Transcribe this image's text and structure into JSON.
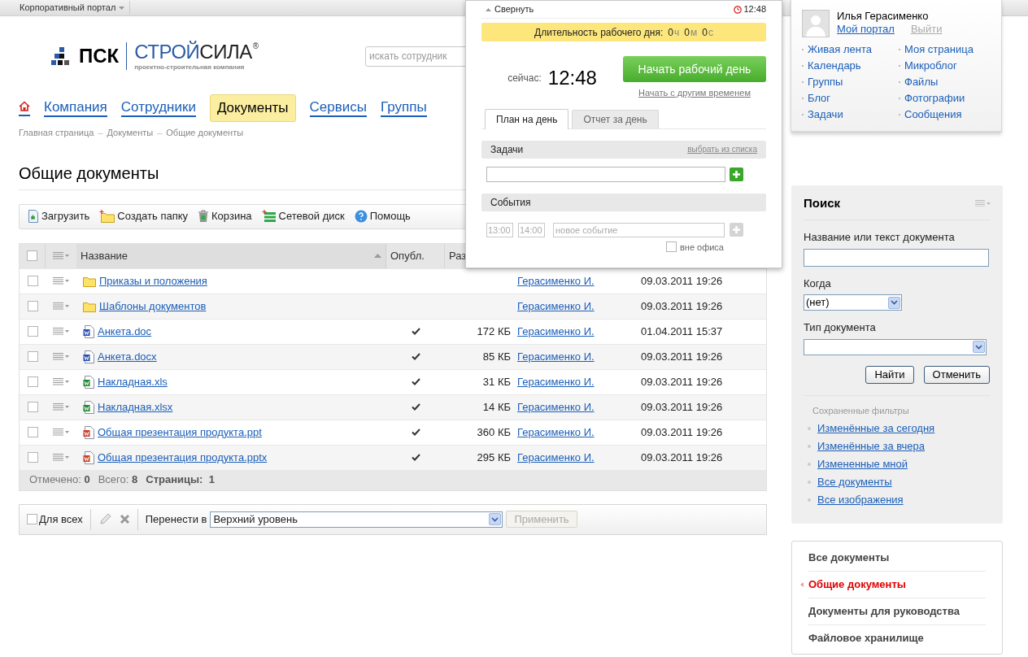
{
  "top_bar": {
    "portal_menu": "Корпоративный портал"
  },
  "logo": {
    "brand": "ПСК",
    "name_first": "СТРОЙ",
    "name_second": "СИЛА",
    "registered": "®",
    "tagline": "проектно-строительная компания"
  },
  "employee_search": {
    "placeholder": "искать сотрудник"
  },
  "nav": [
    {
      "label": "Компания",
      "selected": false
    },
    {
      "label": "Сотрудники",
      "selected": false
    },
    {
      "label": "Документы",
      "selected": true
    },
    {
      "label": "Сервисы",
      "selected": false
    },
    {
      "label": "Группы",
      "selected": false
    }
  ],
  "breadcrumbs": {
    "separator": "–",
    "items": [
      "Главная страница",
      "Документы",
      "Общие документы"
    ]
  },
  "page_title": "Общие документы",
  "toolbar": [
    {
      "label": "Загрузить",
      "kind": "upload"
    },
    {
      "label": "Создать папку",
      "kind": "folder"
    },
    {
      "label": "Корзина",
      "kind": "trash"
    },
    {
      "label": "Сетевой диск",
      "kind": "drive"
    },
    {
      "label": "Помощь",
      "kind": "help"
    }
  ],
  "table": {
    "select_all": {
      "checked": false
    },
    "columns": [
      {
        "label": "Название"
      },
      {
        "label": "Опубл."
      },
      {
        "label": "Раз"
      }
    ],
    "rows": [
      {
        "name": "Приказы и положения",
        "kind": "folder",
        "checked": false,
        "published": false,
        "author": "Герасименко И.",
        "modified": "09.03.2011 19:26"
      },
      {
        "name": "Шаблоны документов",
        "kind": "folder",
        "checked": false,
        "published": false,
        "author": "Герасименко И.",
        "modified": "09.03.2011 19:26"
      },
      {
        "name": "Анкета.doc",
        "kind": "word",
        "checked": false,
        "published": true,
        "size": "172 КБ",
        "author": "Герасименко И.",
        "modified": "01.04.2011 15:37"
      },
      {
        "name": "Анкета.docx",
        "kind": "word",
        "checked": false,
        "published": true,
        "size": "85 КБ",
        "author": "Герасименко И.",
        "modified": "09.03.2011 19:26"
      },
      {
        "name": "Накладная.xls",
        "kind": "excel",
        "checked": false,
        "published": true,
        "size": "31 КБ",
        "author": "Герасименко И.",
        "modified": "09.03.2011 19:26"
      },
      {
        "name": "Накладная.xlsx",
        "kind": "excel",
        "checked": false,
        "published": true,
        "size": "14 КБ",
        "author": "Герасименко И.",
        "modified": "09.03.2011 19:26"
      },
      {
        "name": "Общая презентация продукта.ppt",
        "kind": "powerpoint",
        "checked": false,
        "published": true,
        "size": "360 КБ",
        "author": "Герасименко И.",
        "modified": "09.03.2011 19:26"
      },
      {
        "name": "Общая презентация продукта.pptx",
        "kind": "powerpoint",
        "checked": false,
        "published": true,
        "size": "295 КБ",
        "author": "Герасименко И.",
        "modified": "09.03.2011 19:26"
      }
    ],
    "footer": {
      "marked_label": "Отмечено:",
      "marked": "0",
      "total_label": "Всего:",
      "total": "8",
      "pages_label": "Страницы:",
      "pages": "1"
    }
  },
  "bulk_bar": {
    "for_all": {
      "label": "Для всех",
      "checked": false
    },
    "move_label": "Перенести в",
    "target": "Верхний уровень",
    "apply": {
      "label": "Применить",
      "disabled": true
    }
  },
  "user_panel": {
    "name": "Илья Герасименко",
    "portal_link": "Мой портал",
    "logout": "Выйти",
    "links": [
      "Живая лента",
      "Моя страница",
      "Календарь",
      "Микроблог",
      "Группы",
      "Файлы",
      "Блог",
      "Фотографии",
      "Задачи",
      "Сообщения"
    ]
  },
  "timeman": {
    "collapse": "Свернуть",
    "clock": "12:48",
    "duration_label": "Длительность рабочего дня:",
    "duration": [
      {
        "value": "0",
        "unit": "ч"
      },
      {
        "value": "0",
        "unit": "м"
      },
      {
        "value": "0",
        "unit": "с"
      }
    ],
    "now_label": "сейчас:",
    "now": "12:48",
    "start_button": "Начать рабочий день",
    "start_other": "Начать с другим временем",
    "tabs": [
      {
        "label": "План на день",
        "selected": true
      },
      {
        "label": "Отчет за день",
        "selected": false
      }
    ],
    "tasks": {
      "title": "Задачи",
      "pick": "выбрать из списка"
    },
    "events": {
      "title": "События",
      "from_placeholder": "13:00",
      "to_placeholder": "14:00",
      "placeholder": "новое событие",
      "out_of_office": {
        "label": "вне офиса",
        "checked": false
      }
    }
  },
  "search_panel": {
    "title": "Поиск",
    "fields": [
      {
        "label": "Название или текст документа",
        "kind": "text"
      },
      {
        "label": "Когда",
        "kind": "short_select",
        "value": "(нет)"
      },
      {
        "label": "Тип документа",
        "kind": "select"
      }
    ],
    "buttons": [
      "Найти",
      "Отменить"
    ],
    "saved_title": "Сохраненные фильтры",
    "saved": [
      "Изменённые за сегодня",
      "Изменённые за вчера",
      "Измененные мной",
      "Все документы",
      "Все изображения"
    ]
  },
  "sections": [
    {
      "label": "Все документы",
      "selected": false
    },
    {
      "label": "Общие документы",
      "selected": true
    },
    {
      "label": "Документы для руководства",
      "selected": false
    },
    {
      "label": "Файловое хранилище",
      "selected": false
    }
  ]
}
